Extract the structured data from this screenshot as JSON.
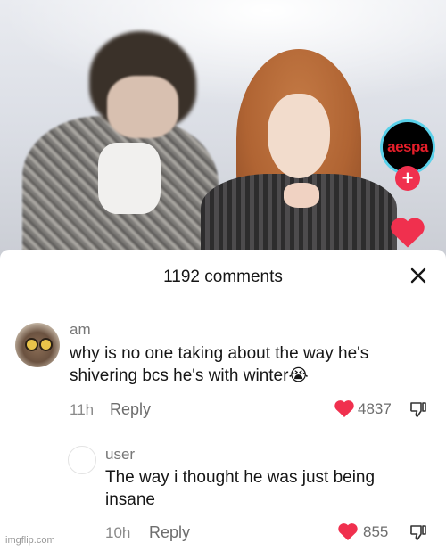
{
  "video": {
    "profile_logo_text": "aespa",
    "follow_symbol": "+"
  },
  "comments_sheet": {
    "title": "1192 comments",
    "comments": [
      {
        "username": "am",
        "text_line1": "why is no one taking about the way he's",
        "text_line2": "shivering bcs he's with winter😭",
        "time": "11h",
        "reply_label": "Reply",
        "likes": "4837"
      },
      {
        "username": "user",
        "text_line1": "The way i thought he was just being",
        "text_line2": "insane",
        "time": "10h",
        "reply_label": "Reply",
        "likes": "855"
      }
    ]
  },
  "watermark": "imgflip.com",
  "colors": {
    "like_red": "#f0304e",
    "profile_ring": "#5ad1ea",
    "logo_red": "#e61e2a"
  },
  "icons": [
    "heart-icon",
    "close-icon",
    "dislike-icon",
    "plus-icon"
  ]
}
